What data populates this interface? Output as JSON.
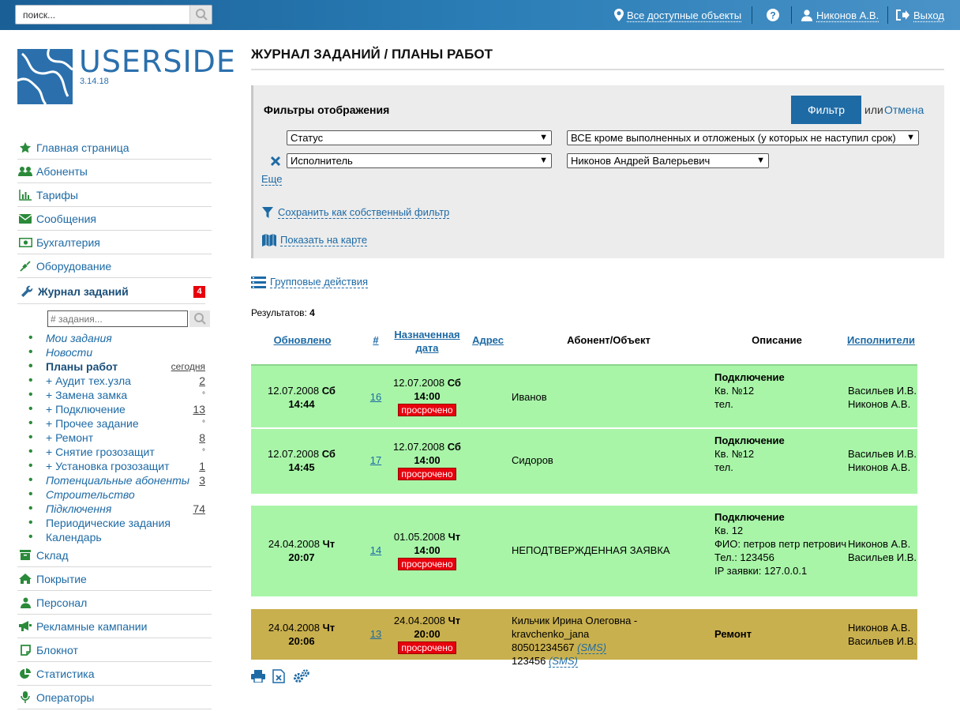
{
  "topbar": {
    "search_placeholder": "поиск...",
    "objects_label": "Все доступные объекты",
    "user_label": "Никонов А.В.",
    "logout_label": "Выход"
  },
  "logo": {
    "name": "USERSIDE",
    "version": "3.14.18"
  },
  "menu": [
    {
      "label": "Главная страница",
      "icon": "star-icon"
    },
    {
      "label": "Абоненты",
      "icon": "users-icon"
    },
    {
      "label": "Тарифы",
      "icon": "bar-chart-icon"
    },
    {
      "label": "Сообщения",
      "icon": "envelope-icon"
    },
    {
      "label": "Бухгалтерия",
      "icon": "money-icon"
    },
    {
      "label": "Оборудование",
      "icon": "plug-icon"
    }
  ],
  "journal": {
    "label": "Журнал заданий",
    "badge": "4",
    "search_placeholder": "# задания..."
  },
  "submenu": [
    {
      "label": "Мои задания",
      "count": ""
    },
    {
      "label": "Новости",
      "count": ""
    },
    {
      "label": "Планы работ",
      "count": "сегодня"
    },
    {
      "label": "+ Аудит тех.узла",
      "count": "2"
    },
    {
      "label": "+ Замена замка",
      "count": "°"
    },
    {
      "label": "+ Подключение",
      "count": "13"
    },
    {
      "label": "+ Прочее задание",
      "count": "°"
    },
    {
      "label": "+ Ремонт",
      "count": "8"
    },
    {
      "label": "+ Снятие грозозащит",
      "count": "°"
    },
    {
      "label": "+ Установка грозозащит",
      "count": "1"
    },
    {
      "label": "Потенциальные абоненты",
      "count": "3"
    },
    {
      "label": "Строительство",
      "count": ""
    },
    {
      "label": "Підключення",
      "count": "74"
    },
    {
      "label": "Периодические задания",
      "count": ""
    },
    {
      "label": "Календарь",
      "count": ""
    }
  ],
  "menu2": [
    {
      "label": "Склад",
      "icon": "box-icon"
    },
    {
      "label": "Покрытие",
      "icon": "home-icon"
    },
    {
      "label": "Персонал",
      "icon": "person-icon"
    },
    {
      "label": "Рекламные кампании",
      "icon": "bullhorn-icon"
    },
    {
      "label": "Блокнот",
      "icon": "notepad-icon"
    },
    {
      "label": "Статистика",
      "icon": "pie-chart-icon"
    },
    {
      "label": "Операторы",
      "icon": "microphone-icon"
    }
  ],
  "page": {
    "title": "ЖУРНАЛ ЗАДАНИЙ / ПЛАНЫ РАБОТ"
  },
  "filters": {
    "title": "Фильтры отображения",
    "filter_button": "Фильтр",
    "or_text": "или",
    "cancel_label": "Отмена",
    "status_select": "Статус",
    "status_value": "ВСЕ кроме выполненных и отложеных (у которых не наступил срок)",
    "executor_select": "Исполнитель",
    "executor_value": "Никонов Андрей Валерьевич",
    "more_label": "Еще",
    "save_filter_label": "Сохранить как собственный фильтр",
    "show_map_label": "Показать на карте"
  },
  "group_actions_label": "Групповые действия",
  "results": {
    "label": "Результатов:",
    "count": "4"
  },
  "table": {
    "headers": {
      "updated": "Обновлено",
      "num": "#",
      "assigned1": "Назначенная",
      "assigned2": "дата",
      "address": "Адрес",
      "subscriber": "Абонент/Объект",
      "description": "Описание",
      "executors": "Исполнители"
    },
    "rows": [
      {
        "color": "#a8f5a8",
        "upd_date": "12.07.2008",
        "upd_day": "Сб",
        "upd_time": "14:44",
        "id": "16",
        "as_date": "12.07.2008",
        "as_day": "Сб",
        "as_time": "14:00",
        "overdue": "просрочено",
        "subscriber": [
          "Иванов"
        ],
        "desc_title": "Подключение",
        "desc_lines": [
          "Кв. №12",
          "тел."
        ],
        "executors": [
          "Васильев И.В.",
          "Никонов А.В."
        ]
      },
      {
        "color": "#a8f5a8",
        "upd_date": "12.07.2008",
        "upd_day": "Сб",
        "upd_time": "14:45",
        "id": "17",
        "as_date": "12.07.2008",
        "as_day": "Сб",
        "as_time": "14:00",
        "overdue": "просрочено",
        "subscriber": [
          "Сидоров"
        ],
        "desc_title": "Подключение",
        "desc_lines": [
          "Кв. №12",
          "тел."
        ],
        "executors": [
          "Васильев И.В.",
          "Никонов А.В."
        ]
      },
      {
        "color": "#a8f5a8",
        "upd_date": "24.04.2008",
        "upd_day": "Чт",
        "upd_time": "20:07",
        "id": "14",
        "as_date": "01.05.2008",
        "as_day": "Чт",
        "as_time": "14:00",
        "overdue": "просрочено",
        "subscriber": [
          "НЕПОДТВЕРЖДЕННАЯ ЗАЯВКА"
        ],
        "desc_title": "Подключение",
        "desc_lines": [
          "Кв. 12",
          "ФИО: петров петр петрович",
          "Тел.: 123456",
          "IP заявки: 127.0.0.1"
        ],
        "executors": [
          "Никонов А.В.",
          "Васильев И.В."
        ]
      },
      {
        "color": "#c9b04e",
        "upd_date": "24.04.2008",
        "upd_day": "Чт",
        "upd_time": "20:06",
        "id": "13",
        "as_date": "24.04.2008",
        "as_day": "Чт",
        "as_time": "20:00",
        "overdue": "просрочено",
        "subscriber": [
          "Кильчик Ирина Олеговна - kravchenko_jana"
        ],
        "phones": [
          {
            "num": "80501234567",
            "sms": "(SMS)"
          },
          {
            "num": "123456",
            "sms": "(SMS)"
          }
        ],
        "desc_title": "Ремонт",
        "desc_lines": [],
        "executors": [
          "Никонов А.В.",
          "Васильев И.В."
        ]
      }
    ]
  },
  "colors": {
    "accent": "#1d6aa5",
    "topbar": "#2a7db6",
    "row_green": "#a8f5a8",
    "row_gold": "#c9b04e",
    "overdue": "#e8000d"
  }
}
